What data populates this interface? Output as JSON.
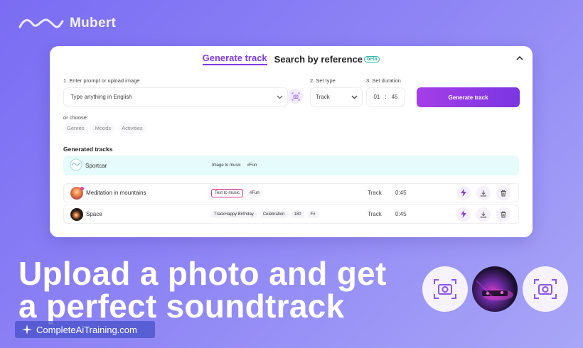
{
  "brand": {
    "name": "Mubert"
  },
  "tabs": [
    {
      "label": "Generate track",
      "active": true
    },
    {
      "label": "Search by reference",
      "active": false,
      "badge": "beta"
    }
  ],
  "form": {
    "prompt_label": "1. Enter prompt or upload image",
    "prompt_placeholder": "Type anything in English",
    "type_label": "2. Set type",
    "type_value": "Track",
    "duration_label": "3. Set duration",
    "duration_min": "01",
    "duration_sep": ":",
    "duration_sec": "45",
    "generate_label": "Generate track",
    "or_choose": "or choose:",
    "chips": [
      "Genres",
      "Moods",
      "Activities"
    ]
  },
  "generated": {
    "title": "Generated tracks",
    "tracks": [
      {
        "name": "Sportcar",
        "tags": [
          "Image to music",
          "#Fun"
        ],
        "type": "",
        "duration": ""
      },
      {
        "name": "Meditation in mountains",
        "tags": [
          "Text to music",
          "#Fun"
        ],
        "type": "Track",
        "duration": "0:45"
      },
      {
        "name": "Space",
        "tags": [
          "TrackHappy Birthday",
          "Celebration",
          "180",
          "F#"
        ],
        "type": "Track",
        "duration": "0:45"
      }
    ]
  },
  "headline": {
    "line1": "Upload a photo and get",
    "line2": "a perfect soundtrack"
  },
  "watermark": {
    "text": "CompleteAiTraining.com"
  },
  "colors": {
    "accent": "#7d3ce0",
    "button_start": "#a63ee8",
    "button_end": "#7a36e2",
    "selected_row": "#e6fbfb",
    "background": "#8f86f5"
  }
}
